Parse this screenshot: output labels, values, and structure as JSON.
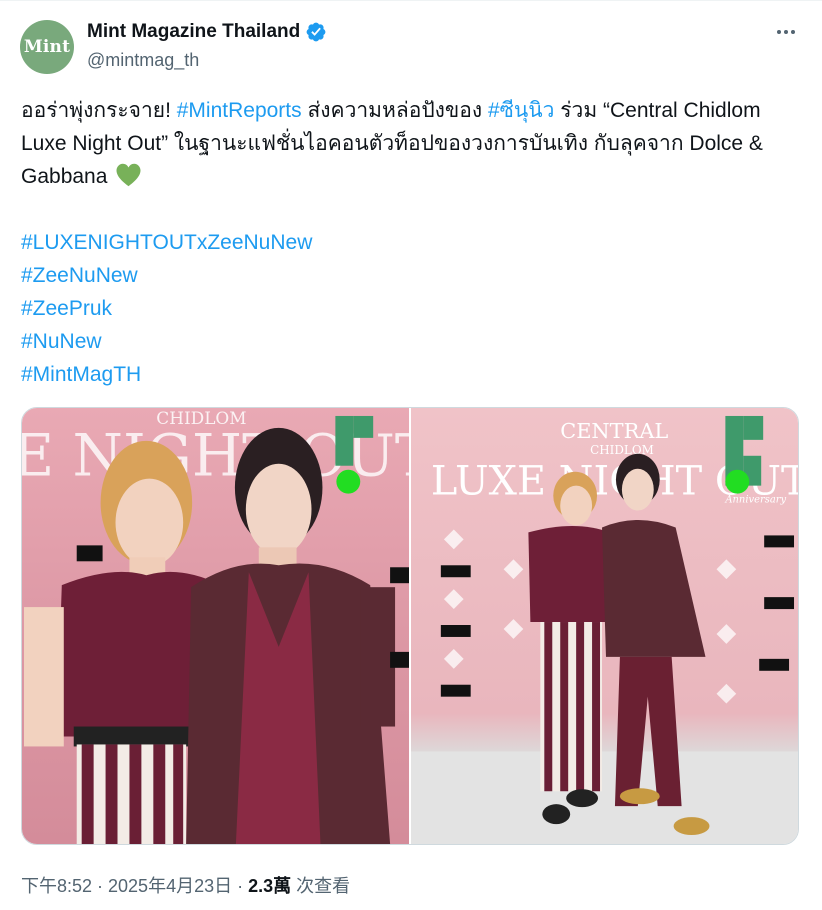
{
  "author": {
    "avatar_text": "Mint",
    "display_name": "Mint Magazine Thailand",
    "handle": "@mintmag_th"
  },
  "tweet": {
    "line1_a": "ออร่าพุ่งกระจาย! ",
    "hashtag_mintreports": "#MintReports",
    "line1_b": " ส่งความหล่อปังของ ",
    "hashtag_zeenunew_th": "#ซีนุนิว",
    "line1_c": "  ร่วม  “Central Chidlom Luxe Night Out” ในฐานะแฟชั่นไอคอนตัวท็อปของวงการบันเทิง กับลุคจาก Dolce & Gabbana",
    "hashtags": [
      "#LUXENIGHTOUTxZeeNuNew",
      "#ZeeNuNew",
      "#ZeePruk",
      "#NuNew",
      "#MintMagTH"
    ]
  },
  "media": {
    "left_backdrop": "CHIDLOM",
    "left_backdrop_big": "E NIGHT OUT",
    "right_brand": "CENTRAL",
    "right_sub": "CHIDLOM",
    "right_title": "LUXE NIGHT OUT",
    "anniversary": "Anniversary"
  },
  "footer": {
    "time": "下午8:52 · 2025年4月23日 · ",
    "views": "2.3萬",
    "views_label": " 次查看"
  },
  "colors": {
    "link": "#1d9bf0",
    "verified": "#1d9bf0",
    "avatar_bg": "#79a97c",
    "heart": "#78b159"
  }
}
